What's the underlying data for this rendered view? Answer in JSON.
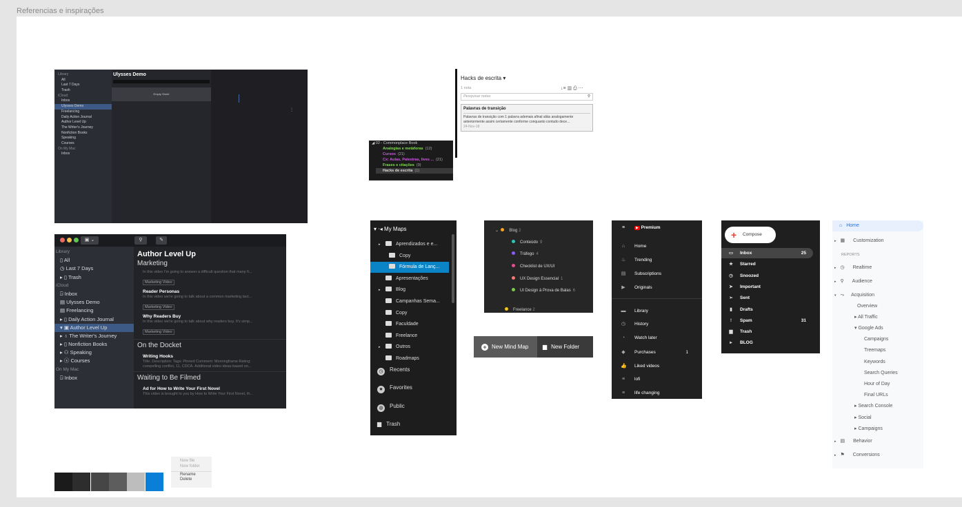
{
  "frame_title": "Referencias e inspirações",
  "ulysses_small": {
    "sidebar": [
      "Library",
      "All",
      "Last 7 Days",
      "Trash",
      "iCloud",
      "Inbox",
      "Ulysses Demo",
      "Freelancing",
      "Daily Action Journal",
      "Author Level Up",
      "The Writer's Journey",
      "Nonfiction Books",
      "Speaking",
      "Courses",
      "On My Mac",
      "Inbox"
    ],
    "title": "Ulysses Demo",
    "empty": "Empty Sheet"
  },
  "ulysses_large": {
    "sidebar": {
      "library": "Library",
      "all": "All",
      "last7": "Last 7 Days",
      "trash": "Trash",
      "icloud": "iCloud",
      "inbox": "Inbox",
      "demo": "Ulysses Demo",
      "freelancing": "Freelancing",
      "journal": "Daily Action Journal",
      "alu": "Author Level Up",
      "writers": "The Writer's Journey",
      "nonfiction": "Nonfiction Books",
      "speaking": "Speaking",
      "courses": "Courses",
      "mymac": "On My Mac",
      "inbox2": "Inbox"
    },
    "title": "Author Level Up",
    "marketing": "Marketing",
    "sheet1": {
      "excerpt": "In this video I'm going to answer a difficult question that many fi...",
      "tag": "Marketing Video"
    },
    "sheet2": {
      "title": "Reader Personas",
      "excerpt": "In this video we're going to talk about a common marketing tact...",
      "tag": "Marketing Video"
    },
    "sheet3": {
      "title": "Why Readers Buy",
      "excerpt": "In this video we're going to talk about why readers buy. It's simp...",
      "tag": "Marketing Video"
    },
    "docket": "On the Docket",
    "sheet4": {
      "title": "Writing Hooks",
      "excerpt1": "Title: Description: Tags: Pinned Comment: Morningframe Rating:",
      "excerpt2": "compelling conflict, 11, CDCA. Additional video ideas based on..."
    },
    "waiting": "Waiting to Be Filmed",
    "sheet5": {
      "title": "Ad for How to Write Your First Novel",
      "excerpt": "This video is brought to you by How to Write Your First Novel, th..."
    }
  },
  "notebook": {
    "header": "◢ 02 - Commonplace Book",
    "items": [
      {
        "name": "Analogias e metáforas",
        "count": "(12)",
        "color": "#7ee04d"
      },
      {
        "name": "Cursos",
        "count": "(21)",
        "color": "#d158e6"
      },
      {
        "name": "Cx: Aulas, Palestras, lives ...",
        "count": "(21)",
        "color": "#d158e6"
      },
      {
        "name": "Frases e citações",
        "count": "(9)",
        "color": "#7ee04d"
      },
      {
        "name": "Hacks de escrita",
        "count": "(1)",
        "color": "#dddddd"
      }
    ]
  },
  "notes": {
    "title": "Hacks de escrita ▾",
    "count": "1 nota",
    "search": "Pesquisar notas",
    "card_title": "Palavras de transição",
    "card_text": "Palavras de transição com 1 palavra ademais afinal aliás analogamente anteriormente assim certamente conforme conquanto contudo dece...",
    "card_date": "24-Nov-18"
  },
  "mymaps": {
    "title": "My Maps",
    "items": [
      "Aprendizados e e...",
      "Copy",
      "Fórmula de Lanç...",
      "Apresentações",
      "Blog",
      "Campanhas Sema...",
      "Copy",
      "Faculdade",
      "Freelance",
      "Outros",
      "Roadmaps"
    ],
    "recents": "Recents",
    "favorites": "Favorites",
    "public": "Public",
    "trash": "Trash"
  },
  "blog": {
    "title": "Blog",
    "count": "2",
    "items": [
      {
        "label": "Conteúdo",
        "count": "9",
        "color": "#2ec4b6"
      },
      {
        "label": "Tráfego",
        "count": "4",
        "color": "#8a5cf6"
      },
      {
        "label": "Checklist de UX/UI",
        "count": "",
        "color": "#e0508a"
      },
      {
        "label": "UX Design Essencial",
        "count": "1",
        "color": "#f07c7c"
      },
      {
        "label": "UI Design à Prova de Balas",
        "count": "6",
        "color": "#7ec850"
      }
    ],
    "freelance": "Freelance",
    "freelance_count": "2"
  },
  "mindmap_bar": {
    "new_map": "New Mind Map",
    "new_folder": "New Folder"
  },
  "youtube": {
    "brand": "Premium",
    "items": [
      {
        "label": "Home",
        "icon": "⌂"
      },
      {
        "label": "Trending",
        "icon": "♨"
      },
      {
        "label": "Subscriptions",
        "icon": "▤"
      },
      {
        "label": "Originals",
        "icon": "▶"
      },
      {
        "label": "Library",
        "icon": "▬"
      },
      {
        "label": "History",
        "icon": "◷"
      },
      {
        "label": "Watch later",
        "icon": "◔"
      },
      {
        "label": "Purchases",
        "icon": "◆",
        "count": "1"
      },
      {
        "label": "Liked videos",
        "icon": "👍"
      },
      {
        "label": "lofi",
        "icon": "≡"
      },
      {
        "label": "life changing",
        "icon": "≡"
      }
    ]
  },
  "gmail": {
    "compose": "Compose",
    "items": [
      {
        "label": "Inbox",
        "count": "25",
        "icon": "▭"
      },
      {
        "label": "Starred",
        "icon": "★"
      },
      {
        "label": "Snoozed",
        "icon": "◷"
      },
      {
        "label": "Important",
        "icon": "➤"
      },
      {
        "label": "Sent",
        "icon": "➢"
      },
      {
        "label": "Drafts",
        "icon": "▮"
      },
      {
        "label": "Spam",
        "count": "31",
        "icon": "!"
      },
      {
        "label": "Trash",
        "icon": "▆"
      },
      {
        "label": "BLOG",
        "icon": "▸"
      }
    ]
  },
  "analytics": {
    "home": "Home",
    "customization": "Customization",
    "reports": "REPORTS",
    "realtime": "Realtime",
    "audience": "Audience",
    "acquisition": "Acquisition",
    "overview": "Overview",
    "all_traffic": "All Traffic",
    "google_ads": "Google Ads",
    "campaigns": "Campaigns",
    "treemaps": "Treemaps",
    "keywords": "Keywords",
    "search_queries": "Search Queries",
    "hour_of_day": "Hour of Day",
    "final_urls": "Final URLs",
    "search_console": "Search Console",
    "social": "Social",
    "campaigns2": "Campaigns",
    "behavior": "Behavior",
    "conversions": "Conversions"
  },
  "swatches": [
    "#1b1b1b",
    "#2d2d2d",
    "#464646",
    "#5d5d5d",
    "#bdbdbd",
    "#0a7fd8"
  ],
  "context_menu": {
    "new_file": "New file",
    "new_folder": "New folder",
    "rename": "Rename",
    "delete": "Delete"
  }
}
